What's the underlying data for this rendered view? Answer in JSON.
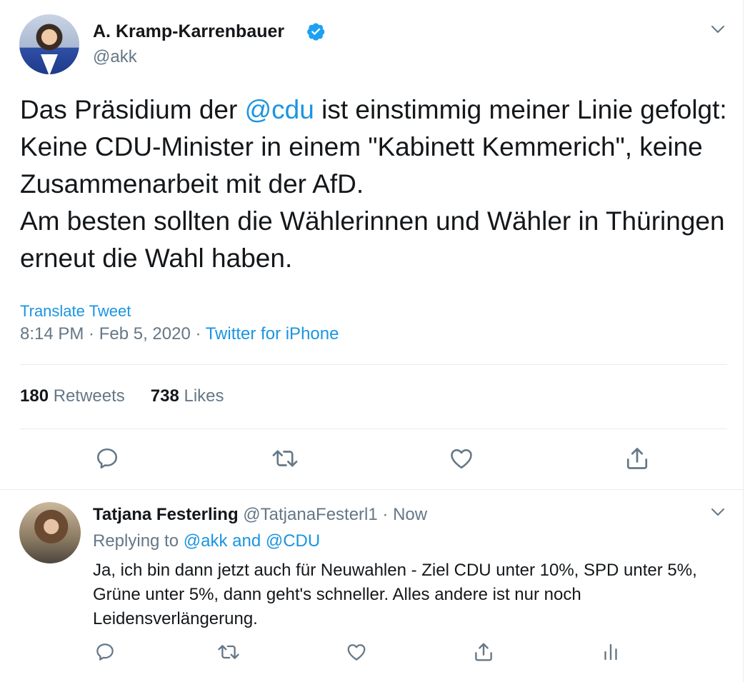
{
  "main_tweet": {
    "author_name": "A. Kramp-Karrenbauer",
    "author_handle": "@akk",
    "text_part1": "Das Präsidium der ",
    "text_mention": "@cdu",
    "text_part2": " ist einstimmig meiner Linie gefolgt: Keine CDU-Minister in einem \"Kabinett Kemmerich\", keine Zusammenarbeit mit der AfD.",
    "text_line2": "Am besten sollten die Wählerinnen und Wähler in Thüringen erneut die Wahl  haben.",
    "translate_label": "Translate Tweet",
    "timestamp": "8:14 PM · Feb 5, 2020 · ",
    "source": "Twitter for iPhone",
    "retweets_count": "180",
    "retweets_label": "Retweets",
    "likes_count": "738",
    "likes_label": "Likes"
  },
  "reply_tweet": {
    "author_name": "Tatjana Festerling",
    "author_handle": "@TatjanaFesterl1",
    "time": " · Now",
    "replying_prefix": "Replying to ",
    "replying_to_1": "@akk",
    "replying_and": " and ",
    "replying_to_2": "@CDU",
    "text": "Ja, ich bin dann jetzt auch für Neuwahlen - Ziel CDU unter 10%, SPD unter 5%, Grüne unter 5%, dann geht's schneller. Alles andere ist nur noch Leidensverlängerung."
  },
  "icons": {
    "verified": "verified-badge-icon",
    "more": "chevron-down-icon",
    "reply": "reply-icon",
    "retweet": "retweet-icon",
    "like": "heart-icon",
    "share": "share-icon",
    "analytics": "analytics-icon"
  },
  "colors": {
    "accent": "#1b95e0",
    "text": "#14171a",
    "secondary": "#657786",
    "divider": "#e6ecf0"
  }
}
